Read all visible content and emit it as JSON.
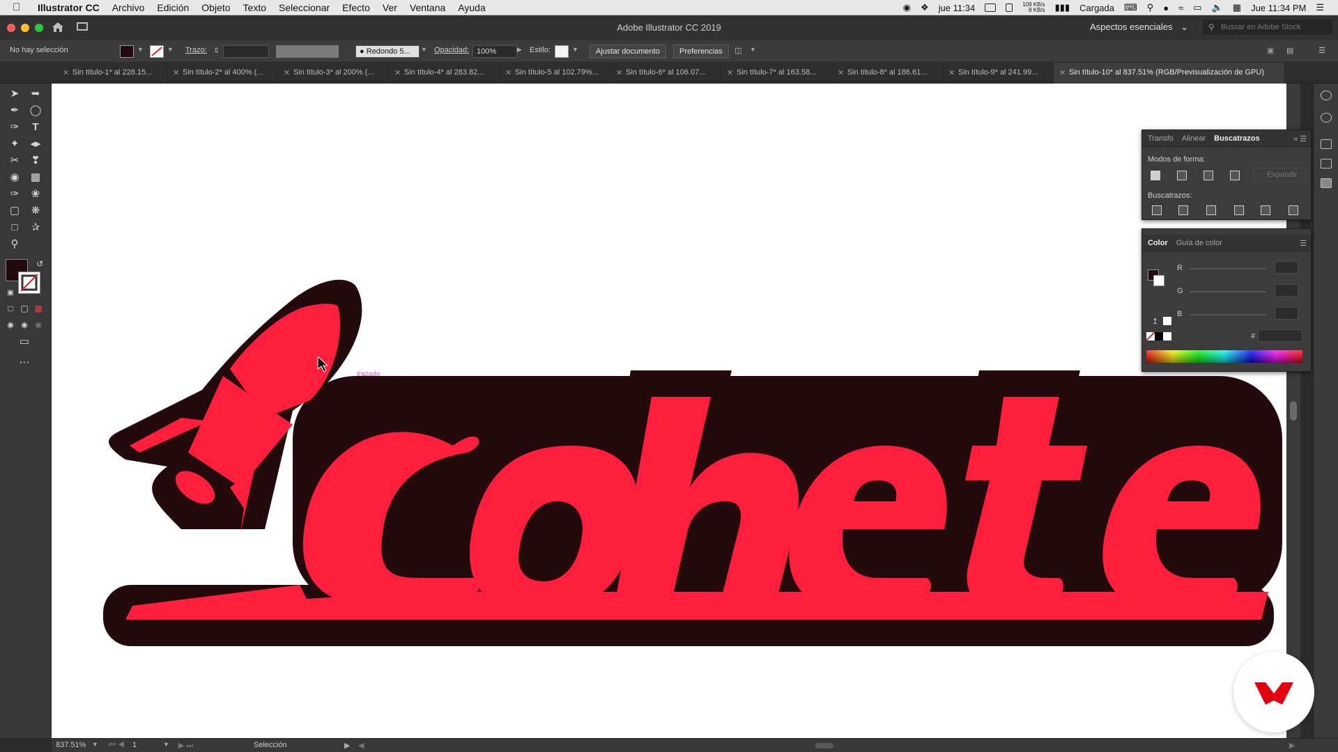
{
  "menubar": {
    "app_name": "Illustrator CC",
    "menus": [
      "Archivo",
      "Edición",
      "Objeto",
      "Texto",
      "Seleccionar",
      "Efecto",
      "Ver",
      "Ventana",
      "Ayuda"
    ],
    "status_time_short": "jue 11:34",
    "net_up": "109 KB/s",
    "net_down": "8 KB/s",
    "battery_label": "Cargada",
    "clock": "Jue 11:34 PM"
  },
  "titlebar": {
    "title": "Adobe Illustrator CC 2019",
    "workspace": "Aspectos esenciales",
    "stock_placeholder": "Buscar en Adobe Stock"
  },
  "controlbar": {
    "selection_label": "No hay selección",
    "stroke_label": "Trazo:",
    "brush_label": "Redondo 5...",
    "opacity_label": "Opacidad:",
    "opacity_value": "100%",
    "style_label": "Estilo:",
    "fit_button": "Ajustar documento",
    "prefs_button": "Preferencias"
  },
  "tabs": [
    {
      "label": "Sin título-1* al 228.15..."
    },
    {
      "label": "Sin título-2* al 400% (..."
    },
    {
      "label": "Sin título-3* al 200% (..."
    },
    {
      "label": "Sin título-4* al 283.82..."
    },
    {
      "label": "Sin título-5 al 102.79%..."
    },
    {
      "label": "Sin título-6* al 106.07..."
    },
    {
      "label": "Sin título-7* al 163.58..."
    },
    {
      "label": "Sin título-8* al 186.61..."
    },
    {
      "label": "Sin título-9* al 241.99..."
    },
    {
      "label": "Sin título-10* al 837.51% (RGB/Previsualización de GPU)"
    }
  ],
  "canvas": {
    "artwork_text": "Cohete",
    "path_hint": "trazado",
    "fill_color": "#ff1e3c",
    "outline_color": "#230a0d"
  },
  "pathfinder_panel": {
    "tabs": [
      "Transfo",
      "Alinear",
      "Buscatrazos"
    ],
    "shape_modes_label": "Modos de forma:",
    "expand_button": "Expandir",
    "pathfinders_label": "Buscatrazos:"
  },
  "color_panel": {
    "tabs": [
      "Color",
      "Guía de color"
    ],
    "channels": [
      "R",
      "G",
      "B"
    ],
    "hex_label": "#"
  },
  "statusbar": {
    "zoom": "837.51%",
    "artboard_number": "1",
    "tool_name": "Selección"
  }
}
